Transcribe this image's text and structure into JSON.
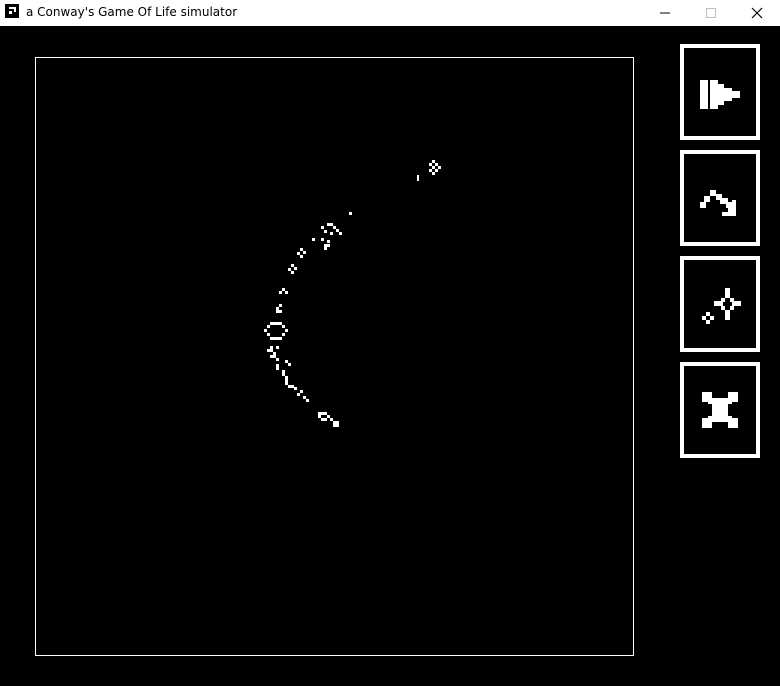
{
  "window": {
    "title": "a Conway's Game Of Life simulator",
    "icon": "app-icon",
    "controls": [
      "minimize-icon",
      "maximize-icon",
      "close-icon"
    ]
  },
  "toolbar": {
    "buttons": [
      {
        "name": "play-step-button",
        "icon": "play-icon"
      },
      {
        "name": "step-button",
        "icon": "step-arrow-icon"
      },
      {
        "name": "randomize-button",
        "icon": "sparkle-icon"
      },
      {
        "name": "clear-button",
        "icon": "clear-x-icon"
      }
    ]
  },
  "colors": {
    "background": "#000000",
    "cells": "#ffffff",
    "titlebar": "#ffffff"
  }
}
